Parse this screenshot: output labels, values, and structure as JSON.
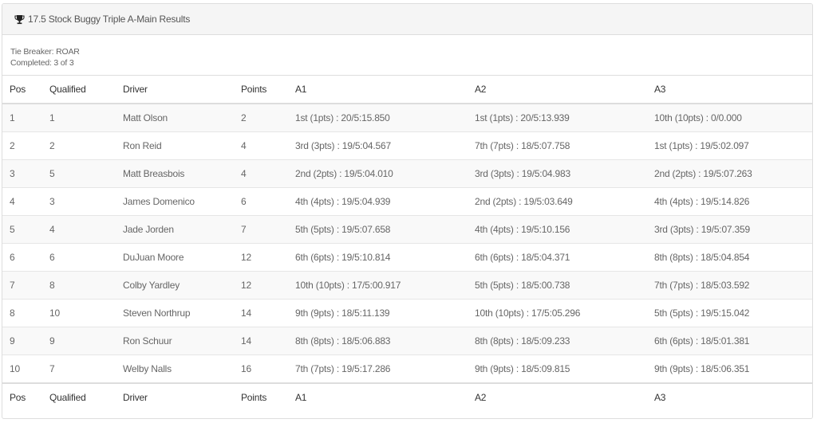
{
  "panel": {
    "title": "17.5 Stock Buggy Triple A-Main Results",
    "icon": "trophy-icon",
    "tie_breaker": "Tie Breaker: ROAR",
    "completed": "Completed: 3 of 3"
  },
  "table": {
    "headers": [
      "Pos",
      "Qualified",
      "Driver",
      "Points",
      "A1",
      "A2",
      "A3"
    ],
    "rows": [
      [
        "1",
        "1",
        "Matt Olson",
        "2",
        "1st (1pts) : 20/5:15.850",
        "1st (1pts) : 20/5:13.939",
        "10th (10pts) : 0/0.000"
      ],
      [
        "2",
        "2",
        "Ron Reid",
        "4",
        "3rd (3pts) : 19/5:04.567",
        "7th (7pts) : 18/5:07.758",
        "1st (1pts) : 19/5:02.097"
      ],
      [
        "3",
        "5",
        "Matt Breasbois",
        "4",
        "2nd (2pts) : 19/5:04.010",
        "3rd (3pts) : 19/5:04.983",
        "2nd (2pts) : 19/5:07.263"
      ],
      [
        "4",
        "3",
        "James Domenico",
        "6",
        "4th (4pts) : 19/5:04.939",
        "2nd (2pts) : 19/5:03.649",
        "4th (4pts) : 19/5:14.826"
      ],
      [
        "5",
        "4",
        "Jade Jorden",
        "7",
        "5th (5pts) : 19/5:07.658",
        "4th (4pts) : 19/5:10.156",
        "3rd (3pts) : 19/5:07.359"
      ],
      [
        "6",
        "6",
        "DuJuan Moore",
        "12",
        "6th (6pts) : 19/5:10.814",
        "6th (6pts) : 18/5:04.371",
        "8th (8pts) : 18/5:04.854"
      ],
      [
        "7",
        "8",
        "Colby Yardley",
        "12",
        "10th (10pts) : 17/5:00.917",
        "5th (5pts) : 18/5:00.738",
        "7th (7pts) : 18/5:03.592"
      ],
      [
        "8",
        "10",
        "Steven Northrup",
        "14",
        "9th (9pts) : 18/5:11.139",
        "10th (10pts) : 17/5:05.296",
        "5th (5pts) : 19/5:15.042"
      ],
      [
        "9",
        "9",
        "Ron Schuur",
        "14",
        "8th (8pts) : 18/5:06.883",
        "8th (8pts) : 18/5:09.233",
        "6th (6pts) : 18/5:01.381"
      ],
      [
        "10",
        "7",
        "Welby Nalls",
        "16",
        "7th (7pts) : 19/5:17.286",
        "9th (9pts) : 18/5:09.815",
        "9th (9pts) : 18/5:06.351"
      ]
    ]
  }
}
